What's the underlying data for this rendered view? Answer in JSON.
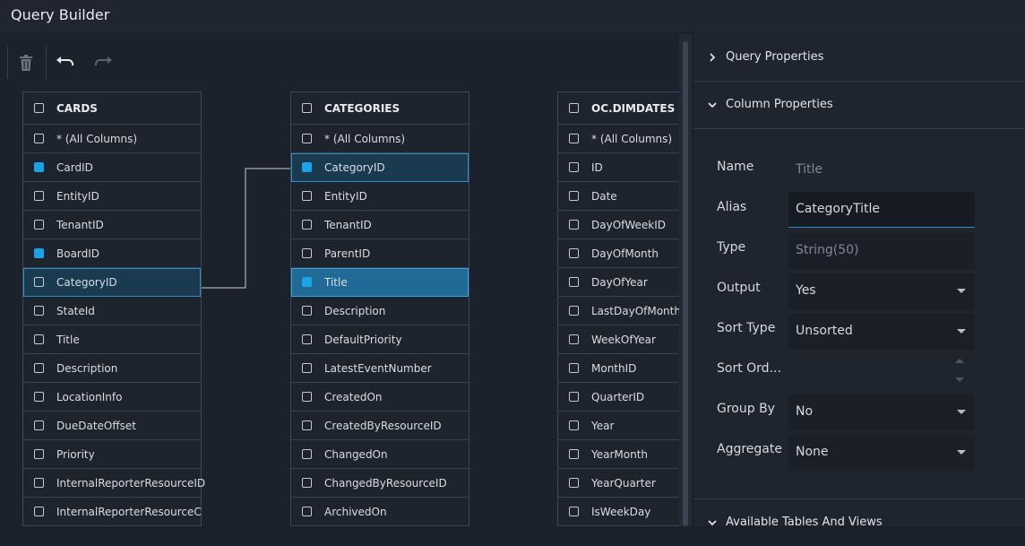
{
  "window": {
    "title": "Query Builder"
  },
  "toolbar": {
    "delete_icon": "trash-icon",
    "undo_icon": "undo-icon",
    "redo_icon": "redo-icon"
  },
  "tables": [
    {
      "name": "CARDS",
      "checked": false,
      "columns": [
        {
          "label": "* (All Columns)",
          "checked": false,
          "state": ""
        },
        {
          "label": "CardID",
          "checked": true,
          "state": ""
        },
        {
          "label": "EntityID",
          "checked": false,
          "state": ""
        },
        {
          "label": "TenantID",
          "checked": false,
          "state": ""
        },
        {
          "label": "BoardID",
          "checked": true,
          "state": ""
        },
        {
          "label": "CategoryID",
          "checked": false,
          "state": "sel"
        },
        {
          "label": "StateId",
          "checked": false,
          "state": ""
        },
        {
          "label": "Title",
          "checked": false,
          "state": ""
        },
        {
          "label": "Description",
          "checked": false,
          "state": ""
        },
        {
          "label": "LocationInfo",
          "checked": false,
          "state": ""
        },
        {
          "label": "DueDateOffset",
          "checked": false,
          "state": ""
        },
        {
          "label": "Priority",
          "checked": false,
          "state": ""
        },
        {
          "label": "InternalReporterResourceID",
          "checked": false,
          "state": ""
        },
        {
          "label": "InternalReporterResourceC",
          "checked": false,
          "state": ""
        }
      ]
    },
    {
      "name": "CATEGORIES",
      "checked": false,
      "columns": [
        {
          "label": "* (All Columns)",
          "checked": false,
          "state": ""
        },
        {
          "label": "CategoryID",
          "checked": true,
          "state": "sel"
        },
        {
          "label": "EntityID",
          "checked": false,
          "state": ""
        },
        {
          "label": "TenantID",
          "checked": false,
          "state": ""
        },
        {
          "label": "ParentID",
          "checked": false,
          "state": ""
        },
        {
          "label": "Title",
          "checked": true,
          "state": "selstrong"
        },
        {
          "label": "Description",
          "checked": false,
          "state": ""
        },
        {
          "label": "DefaultPriority",
          "checked": false,
          "state": ""
        },
        {
          "label": "LatestEventNumber",
          "checked": false,
          "state": ""
        },
        {
          "label": "CreatedOn",
          "checked": false,
          "state": ""
        },
        {
          "label": "CreatedByResourceID",
          "checked": false,
          "state": ""
        },
        {
          "label": "ChangedOn",
          "checked": false,
          "state": ""
        },
        {
          "label": "ChangedByResourceID",
          "checked": false,
          "state": ""
        },
        {
          "label": "ArchivedOn",
          "checked": false,
          "state": ""
        }
      ]
    },
    {
      "name": "OC.DIMDATES",
      "checked": false,
      "columns": [
        {
          "label": "* (All Columns)",
          "checked": false,
          "state": ""
        },
        {
          "label": "ID",
          "checked": false,
          "state": ""
        },
        {
          "label": "Date",
          "checked": false,
          "state": ""
        },
        {
          "label": "DayOfWeekID",
          "checked": false,
          "state": ""
        },
        {
          "label": "DayOfMonth",
          "checked": false,
          "state": ""
        },
        {
          "label": "DayOfYear",
          "checked": false,
          "state": ""
        },
        {
          "label": "LastDayOfMonth",
          "checked": false,
          "state": ""
        },
        {
          "label": "WeekOfYear",
          "checked": false,
          "state": ""
        },
        {
          "label": "MonthID",
          "checked": false,
          "state": ""
        },
        {
          "label": "QuarterID",
          "checked": false,
          "state": ""
        },
        {
          "label": "Year",
          "checked": false,
          "state": ""
        },
        {
          "label": "YearMonth",
          "checked": false,
          "state": ""
        },
        {
          "label": "YearQuarter",
          "checked": false,
          "state": ""
        },
        {
          "label": "IsWeekDay",
          "checked": false,
          "state": ""
        }
      ]
    }
  ],
  "panel": {
    "query_properties": "Query Properties",
    "column_properties": "Column Properties",
    "available_tables": "Available Tables And Views",
    "name_label": "Name",
    "name_value": "Title",
    "alias_label": "Alias",
    "alias_value": "CategoryTitle",
    "type_label": "Type",
    "type_value": "String(50)",
    "output_label": "Output",
    "output_value": "Yes",
    "sort_type_label": "Sort Type",
    "sort_type_value": "Unsorted",
    "sort_order_label": "Sort Ord...",
    "sort_order_value": "",
    "group_by_label": "Group By",
    "group_by_value": "No",
    "aggregate_label": "Aggregate",
    "aggregate_value": "None"
  },
  "colors": {
    "accent": "#1aa3e6",
    "selected_row": "#1f6a96",
    "background": "#1b212b"
  }
}
